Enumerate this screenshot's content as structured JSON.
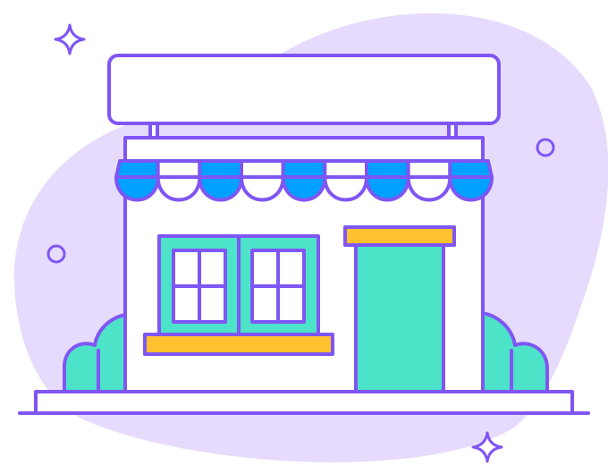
{
  "illustration": {
    "subject": "storefront",
    "colors": {
      "outline": "#7f56f3",
      "background_blob": "#e6dbfc",
      "awning_blue": "#00a0ff",
      "awning_white": "#ffffff",
      "teal": "#4de3c8",
      "yellow": "#ffc22e",
      "white": "#ffffff"
    },
    "icons": [
      "sparkle-icon",
      "sparkle-icon",
      "ring-icon",
      "ring-icon"
    ],
    "awning_scallops": 9,
    "window_panes_per_sash": 4
  }
}
